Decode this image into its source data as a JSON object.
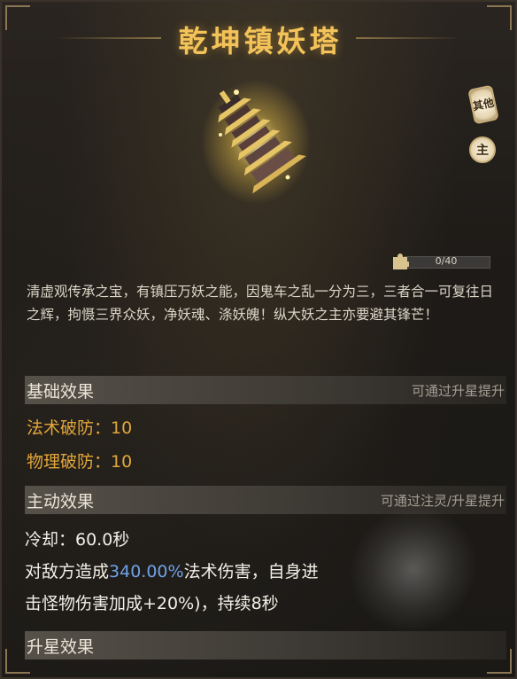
{
  "title": "乾坤镇妖塔",
  "side_buttons": {
    "other": "其他",
    "main": "主"
  },
  "progress": {
    "text": "0/40",
    "value": 0,
    "max": 40
  },
  "description": "清虚观传承之宝，有镇压万妖之能，因鬼车之乱一分为三，三者合一可复往日之辉，拘慑三界众妖，净妖魂、涤妖魄！纵大妖之主亦要避其锋芒！",
  "basic": {
    "header": "基础效果",
    "hint": "可通过升星提升",
    "stats": [
      "法术破防：10",
      "物理破防：10"
    ]
  },
  "active": {
    "header": "主动效果",
    "hint": "可通过注灵/升星提升",
    "cooldown": "冷却：60.0秒",
    "line1_prefix": "对敌方造成",
    "line1_highlight": "340.00%",
    "line1_suffix": "法术伤害，自身进",
    "line2": "击怪物伤害加成+20%)，持续8秒"
  },
  "star": {
    "header": "升星效果"
  },
  "colors": {
    "title": "#f3c35a",
    "stat": "#e3a63b",
    "highlight": "#6fa2e8"
  }
}
